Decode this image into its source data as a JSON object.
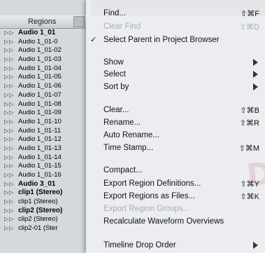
{
  "regions_panel": {
    "header": "Regions",
    "rows": [
      {
        "name": "Audio 1_01",
        "bold": true
      },
      {
        "name": "Audio 1_01-0",
        "bold": false
      },
      {
        "name": "Audio 1_01-02",
        "bold": false
      },
      {
        "name": "Audio 1_01-03",
        "bold": false
      },
      {
        "name": "Audio 1_01-04",
        "bold": false
      },
      {
        "name": "Audio 1_01-05",
        "bold": false
      },
      {
        "name": "Audio 1_01-06",
        "bold": false
      },
      {
        "name": "Audio 1_01-07",
        "bold": false
      },
      {
        "name": "Audio 1_01-08",
        "bold": false
      },
      {
        "name": "Audio 1_01-09",
        "bold": false
      },
      {
        "name": "Audio 1_01-10",
        "bold": false
      },
      {
        "name": "Audio 1_01-11",
        "bold": false
      },
      {
        "name": "Audio 1_01-12",
        "bold": false
      },
      {
        "name": "Audio 1_01-13",
        "bold": false
      },
      {
        "name": "Audio 1_01-14",
        "bold": false
      },
      {
        "name": "Audio 1_01-15",
        "bold": false
      },
      {
        "name": "Audio 1_01-16",
        "bold": false
      },
      {
        "name": "Audio 3_01",
        "bold": true
      },
      {
        "name": "clip1 (Stereo)",
        "bold": true
      },
      {
        "name": "clip1 (Stereo)",
        "bold": false
      },
      {
        "name": "clip2 (Stereo)",
        "bold": true
      },
      {
        "name": "clip2 (Stereo)",
        "bold": false
      },
      {
        "name": "clip2-01 (Ster",
        "bold": false
      }
    ]
  },
  "menu": {
    "items": [
      {
        "label": "Find...",
        "shortcut": "⇧⌘F",
        "check": "",
        "submenu": false,
        "disabled": false
      },
      {
        "label": "Clear Find",
        "shortcut": "⇧⌘D",
        "check": "",
        "submenu": false,
        "disabled": true
      },
      {
        "label": "Select Parent in Project Browser",
        "shortcut": "",
        "check": "✓",
        "submenu": false,
        "disabled": false
      },
      {
        "label": "Show",
        "shortcut": "",
        "check": "",
        "submenu": true,
        "disabled": false
      },
      {
        "label": "Select",
        "shortcut": "",
        "check": "",
        "submenu": true,
        "disabled": false
      },
      {
        "label": "Sort by",
        "shortcut": "",
        "check": "",
        "submenu": true,
        "disabled": false
      },
      {
        "label": "Clear...",
        "shortcut": "⇧⌘B",
        "check": "",
        "submenu": false,
        "disabled": false
      },
      {
        "label": "Rename...",
        "shortcut": "⇧⌘R",
        "check": "",
        "submenu": false,
        "disabled": false
      },
      {
        "label": "Auto Rename...",
        "shortcut": "",
        "check": "",
        "submenu": false,
        "disabled": false
      },
      {
        "label": "Time Stamp...",
        "shortcut": "⇧⌘M",
        "check": "",
        "submenu": false,
        "disabled": false
      },
      {
        "label": "Compact...",
        "shortcut": "",
        "check": "",
        "submenu": false,
        "disabled": false
      },
      {
        "label": "Export Region Definitions...",
        "shortcut": "⇧⌘Y",
        "check": "",
        "submenu": false,
        "disabled": false
      },
      {
        "label": "Export Regions as Files...",
        "shortcut": "⇧⌘K",
        "check": "",
        "submenu": false,
        "disabled": false
      },
      {
        "label": "Export Region Groups...",
        "shortcut": "",
        "check": "",
        "submenu": false,
        "disabled": true
      },
      {
        "label": "Recalculate Waveform Overviews",
        "shortcut": "",
        "check": "",
        "submenu": false,
        "disabled": false
      },
      {
        "label": "Timeline Drop Order",
        "shortcut": "",
        "check": "",
        "submenu": true,
        "disabled": false
      }
    ]
  }
}
